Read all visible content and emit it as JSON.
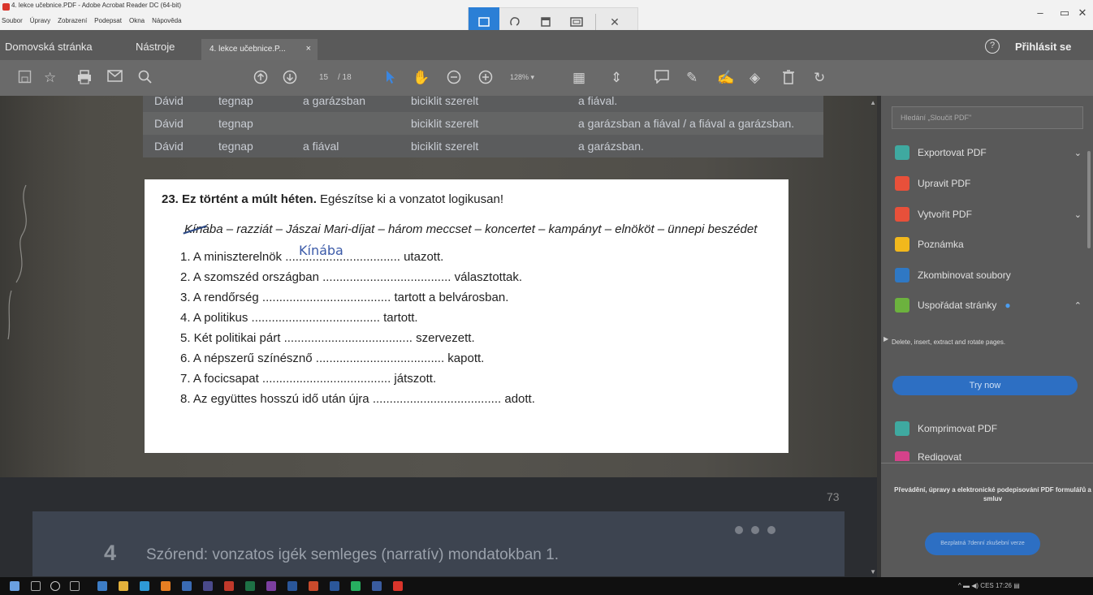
{
  "window": {
    "title": "4. lekce učebnice.PDF - Adobe Acrobat Reader DC (64-bit)",
    "menu": [
      "Soubor",
      "Úpravy",
      "Zobrazení",
      "Podepsat",
      "Okna",
      "Nápověda"
    ],
    "minimize": "–",
    "maximize": "▭",
    "close": "✕"
  },
  "snip_toolbar": {
    "close": "✕"
  },
  "tabs": {
    "home": "Domovská stránka",
    "tools": "Nástroje",
    "document": "4. lekce učebnice.P...",
    "document_close": "×",
    "help": "?",
    "login": "Přihlásit se"
  },
  "toolbar": {
    "page_current": "15",
    "page_total": "/ 18",
    "zoom": "128%"
  },
  "document": {
    "table_rows": [
      {
        "c1": "Dávid",
        "c2": "tegnap",
        "c3": "a garázsban",
        "c4": "biciklit szerelt",
        "c5": "a fiával."
      },
      {
        "c1": "Dávid",
        "c2": "tegnap",
        "c3": "",
        "c4": "biciklit szerelt",
        "c5": "a garázsban a fiával / a fiával a garázsban."
      },
      {
        "c1": "Dávid",
        "c2": "tegnap",
        "c3": "a fiával",
        "c4": "biciklit szerelt",
        "c5": "a garázsban."
      }
    ],
    "exercise": {
      "number": "23. Ez történt a múlt héten.",
      "instruction": "Egészítse ki a vonzatot logikusan!",
      "word_first": "Kínába",
      "word_rest": "– razziát – Jászai Mari-díjat – három meccset – koncertet – kampányt – elnököt – ünnepi beszédet",
      "handwritten_answer": "Kínába",
      "items": [
        "1. A miniszterelnök .................................. utazott.",
        "2. A szomszéd országban ...................................... választottak.",
        "3. A rendőrség ...................................... tartott a belvárosban.",
        "4. A politikus ...................................... tartott.",
        "5. Két politikai párt ...................................... szervezett.",
        "6. A népszerű színésznő ...................................... kapott.",
        "7. A focicsapat ...................................... játszott.",
        "8. Az együttes hosszú idő után újra ...................................... adott."
      ]
    },
    "page_number": "73",
    "chapter_number": "4",
    "chapter_title": "Szórend: vonzatos igék semleges (narratív) mondatokban 1."
  },
  "right_panel": {
    "search_placeholder": "Hledání „Sloučit PDF\"",
    "tools": [
      {
        "label": "Exportovat PDF",
        "icon": "export-pdf-icon",
        "color": "#3fa9a0",
        "chevron": "⌄"
      },
      {
        "label": "Upravit PDF",
        "icon": "edit-pdf-icon",
        "color": "#e8503a",
        "chevron": ""
      },
      {
        "label": "Vytvořit PDF",
        "icon": "create-pdf-icon",
        "color": "#e8503a",
        "chevron": "⌄"
      },
      {
        "label": "Poznámka",
        "icon": "comment-icon",
        "color": "#f2b81c",
        "chevron": ""
      },
      {
        "label": "Zkombinovat soubory",
        "icon": "combine-files-icon",
        "color": "#2f78c4",
        "chevron": ""
      },
      {
        "label": "Uspořádat stránky",
        "icon": "organize-pages-icon",
        "color": "#6cb23e",
        "chevron": "⌃"
      },
      {
        "label": "Komprimovat PDF",
        "icon": "compress-pdf-icon",
        "color": "#3fa9a0",
        "chevron": ""
      },
      {
        "label": "Redigovat",
        "icon": "redact-icon",
        "color": "#d4428a",
        "chevron": ""
      }
    ],
    "organize_description": "Delete, insert, extract and rotate pages.",
    "try_now": "Try now",
    "promo_text": "Převádění, úpravy a elektronické podepisování PDF formulářů a smluv",
    "trial_button": "Bezplatná 7denní zkušební verze"
  },
  "taskbar": {
    "language": "CES",
    "time": "17:26"
  }
}
